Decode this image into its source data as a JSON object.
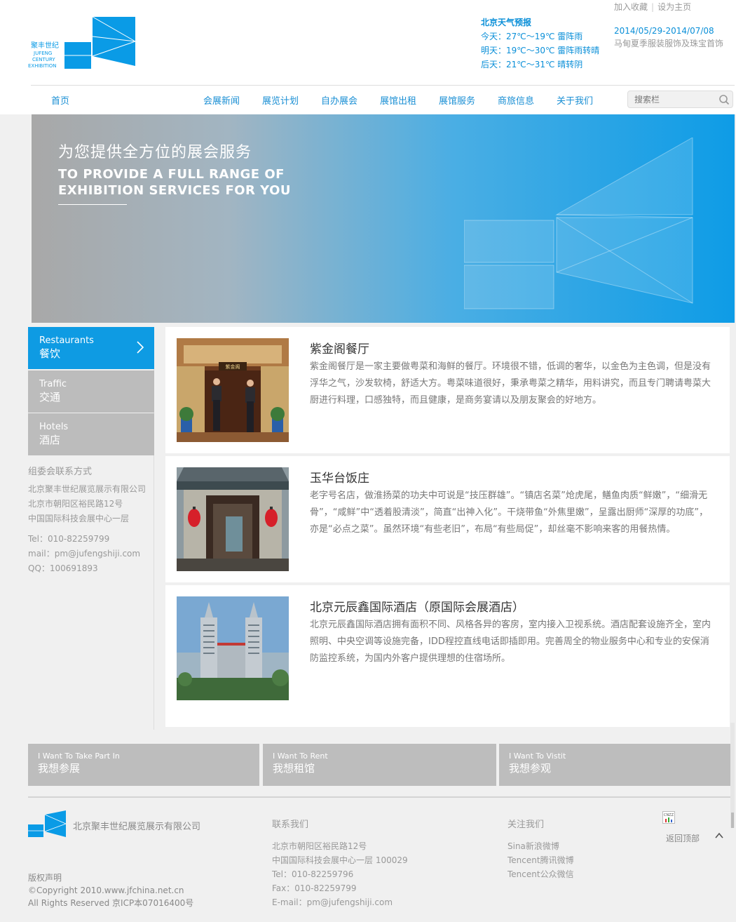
{
  "header": {
    "top_links": [
      "加入收藏",
      "设为主页"
    ],
    "weather": {
      "title": "北京天气预报",
      "today": "今天：27℃～19℃ 雷阵雨",
      "tomorrow": "明天：19℃～30℃ 雷阵雨转晴",
      "after": "后天：21℃～31℃ 晴转阴"
    },
    "event": {
      "date": "2014/05/29-2014/07/08",
      "name": "马甸夏季服装服饰及珠宝首饰"
    },
    "logo_text": [
      "聚丰世纪",
      "JUFENG",
      "CENTURY",
      "EXHIBITION"
    ],
    "brand_color": "#0a9be6"
  },
  "nav": {
    "items": [
      "首页",
      "会展新闻",
      "展览计划",
      "自办展会",
      "展馆出租",
      "展馆服务",
      "商旅信息",
      "关于我们"
    ],
    "search_placeholder": "搜索栏"
  },
  "banner": {
    "title_zh": "为您提供全方位的展会服务",
    "title_en": "TO PROVIDE  A FULL RANGE OF EXHIBITION SERVICES FOR YOU"
  },
  "sidebar": {
    "items": [
      {
        "en": "Restaurants",
        "zh": "餐饮",
        "active": true
      },
      {
        "en": "Traffic",
        "zh": "交通",
        "active": false
      },
      {
        "en": "Hotels",
        "zh": "酒店",
        "active": false
      }
    ],
    "contact": {
      "title": "组委会联系方式",
      "lines": [
        "北京聚丰世纪展览展示有限公司",
        "北京市朝阳区裕民路12号",
        "中国国际科技会展中心一层"
      ],
      "tel": "Tel：010-82259799",
      "mail": "mail：pm@jufengshiji.com",
      "qq": "QQ：100691893"
    }
  },
  "listings": [
    {
      "title": "紫金阁餐厅",
      "sign": "紫金阁",
      "desc": "紫金阁餐厅是一家主要做粤菜和海鲜的餐厅。环境很不错，低调的奢华，以金色为主色调，但是没有浮华之气，沙发软椅，舒适大方。粤菜味道很好，秉承粤菜之精华，用料讲究，而且专门聘请粤菜大厨进行料理，口感独特，而且健康，是商务宴请以及朋友聚会的好地方。"
    },
    {
      "title": "玉华台饭庄",
      "desc": "老字号名店，做淮扬菜的功夫中可说是“技压群雄”。“镇店名菜”炝虎尾，鳝鱼肉质“鲜嫩”，“细滑无骨”，“咸鲜”中“透着股清淡”，简直“出神入化”。干烧带鱼“外焦里嫩”，呈露出厨师“深厚的功底”，亦是“必点之菜”。虽然环境“有些老旧”，布局“有些局促”，却丝毫不影响来客的用餐热情。"
    },
    {
      "title": "北京元辰鑫国际酒店（原国际会展酒店）",
      "desc": "北京元辰鑫国际酒店拥有面积不同、风格各异的客房，室内接入卫视系统。酒店配套设施齐全，室内照明、中央空调等设施完备，IDD程控直线电话即插即用。完善周全的物业服务中心和专业的安保消防监控系统，为国内外客户提供理想的住宿场所。"
    }
  ],
  "actions": [
    {
      "en": "I Want To Take Part In",
      "zh": "我想参展"
    },
    {
      "en": "I Want To Rent",
      "zh": "我想租馆"
    },
    {
      "en": "I Want To Vistit",
      "zh": "我想参观"
    }
  ],
  "footer": {
    "company": "北京聚丰世纪展览展示有限公司",
    "contact_title": "联系我们",
    "contact_lines": [
      "北京市朝阳区裕民路12号",
      "中国国际科技会展中心一层 100029",
      "Tel：010-82259796",
      "Fax：010-82259799",
      "E-mail：pm@jufengshiji.com"
    ],
    "follow_title": "关注我们",
    "follow_links": [
      "Sina新浪微博",
      "Tencent腾讯微博",
      "Tencent公众微信"
    ],
    "copyright": [
      "版权声明",
      "©Copyright 2010.www.jfchina.net.cn",
      "All Rights Reserved 京ICP本07016400号"
    ],
    "back_top": "返回顶部",
    "cnzz": "CNZZ"
  }
}
